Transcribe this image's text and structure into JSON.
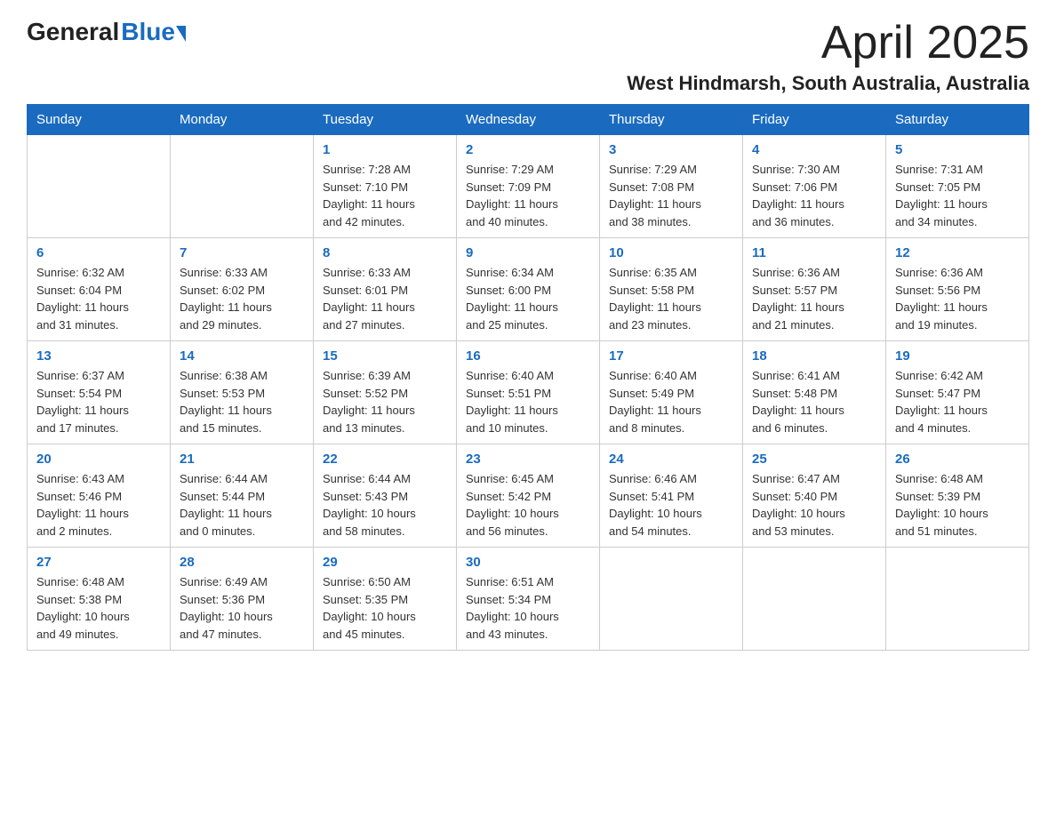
{
  "header": {
    "month_title": "April 2025",
    "location": "West Hindmarsh, South Australia, Australia",
    "logo_general": "General",
    "logo_blue": "Blue"
  },
  "days_of_week": [
    "Sunday",
    "Monday",
    "Tuesday",
    "Wednesday",
    "Thursday",
    "Friday",
    "Saturday"
  ],
  "weeks": [
    [
      {
        "day": "",
        "info": ""
      },
      {
        "day": "",
        "info": ""
      },
      {
        "day": "1",
        "info": "Sunrise: 7:28 AM\nSunset: 7:10 PM\nDaylight: 11 hours\nand 42 minutes."
      },
      {
        "day": "2",
        "info": "Sunrise: 7:29 AM\nSunset: 7:09 PM\nDaylight: 11 hours\nand 40 minutes."
      },
      {
        "day": "3",
        "info": "Sunrise: 7:29 AM\nSunset: 7:08 PM\nDaylight: 11 hours\nand 38 minutes."
      },
      {
        "day": "4",
        "info": "Sunrise: 7:30 AM\nSunset: 7:06 PM\nDaylight: 11 hours\nand 36 minutes."
      },
      {
        "day": "5",
        "info": "Sunrise: 7:31 AM\nSunset: 7:05 PM\nDaylight: 11 hours\nand 34 minutes."
      }
    ],
    [
      {
        "day": "6",
        "info": "Sunrise: 6:32 AM\nSunset: 6:04 PM\nDaylight: 11 hours\nand 31 minutes."
      },
      {
        "day": "7",
        "info": "Sunrise: 6:33 AM\nSunset: 6:02 PM\nDaylight: 11 hours\nand 29 minutes."
      },
      {
        "day": "8",
        "info": "Sunrise: 6:33 AM\nSunset: 6:01 PM\nDaylight: 11 hours\nand 27 minutes."
      },
      {
        "day": "9",
        "info": "Sunrise: 6:34 AM\nSunset: 6:00 PM\nDaylight: 11 hours\nand 25 minutes."
      },
      {
        "day": "10",
        "info": "Sunrise: 6:35 AM\nSunset: 5:58 PM\nDaylight: 11 hours\nand 23 minutes."
      },
      {
        "day": "11",
        "info": "Sunrise: 6:36 AM\nSunset: 5:57 PM\nDaylight: 11 hours\nand 21 minutes."
      },
      {
        "day": "12",
        "info": "Sunrise: 6:36 AM\nSunset: 5:56 PM\nDaylight: 11 hours\nand 19 minutes."
      }
    ],
    [
      {
        "day": "13",
        "info": "Sunrise: 6:37 AM\nSunset: 5:54 PM\nDaylight: 11 hours\nand 17 minutes."
      },
      {
        "day": "14",
        "info": "Sunrise: 6:38 AM\nSunset: 5:53 PM\nDaylight: 11 hours\nand 15 minutes."
      },
      {
        "day": "15",
        "info": "Sunrise: 6:39 AM\nSunset: 5:52 PM\nDaylight: 11 hours\nand 13 minutes."
      },
      {
        "day": "16",
        "info": "Sunrise: 6:40 AM\nSunset: 5:51 PM\nDaylight: 11 hours\nand 10 minutes."
      },
      {
        "day": "17",
        "info": "Sunrise: 6:40 AM\nSunset: 5:49 PM\nDaylight: 11 hours\nand 8 minutes."
      },
      {
        "day": "18",
        "info": "Sunrise: 6:41 AM\nSunset: 5:48 PM\nDaylight: 11 hours\nand 6 minutes."
      },
      {
        "day": "19",
        "info": "Sunrise: 6:42 AM\nSunset: 5:47 PM\nDaylight: 11 hours\nand 4 minutes."
      }
    ],
    [
      {
        "day": "20",
        "info": "Sunrise: 6:43 AM\nSunset: 5:46 PM\nDaylight: 11 hours\nand 2 minutes."
      },
      {
        "day": "21",
        "info": "Sunrise: 6:44 AM\nSunset: 5:44 PM\nDaylight: 11 hours\nand 0 minutes."
      },
      {
        "day": "22",
        "info": "Sunrise: 6:44 AM\nSunset: 5:43 PM\nDaylight: 10 hours\nand 58 minutes."
      },
      {
        "day": "23",
        "info": "Sunrise: 6:45 AM\nSunset: 5:42 PM\nDaylight: 10 hours\nand 56 minutes."
      },
      {
        "day": "24",
        "info": "Sunrise: 6:46 AM\nSunset: 5:41 PM\nDaylight: 10 hours\nand 54 minutes."
      },
      {
        "day": "25",
        "info": "Sunrise: 6:47 AM\nSunset: 5:40 PM\nDaylight: 10 hours\nand 53 minutes."
      },
      {
        "day": "26",
        "info": "Sunrise: 6:48 AM\nSunset: 5:39 PM\nDaylight: 10 hours\nand 51 minutes."
      }
    ],
    [
      {
        "day": "27",
        "info": "Sunrise: 6:48 AM\nSunset: 5:38 PM\nDaylight: 10 hours\nand 49 minutes."
      },
      {
        "day": "28",
        "info": "Sunrise: 6:49 AM\nSunset: 5:36 PM\nDaylight: 10 hours\nand 47 minutes."
      },
      {
        "day": "29",
        "info": "Sunrise: 6:50 AM\nSunset: 5:35 PM\nDaylight: 10 hours\nand 45 minutes."
      },
      {
        "day": "30",
        "info": "Sunrise: 6:51 AM\nSunset: 5:34 PM\nDaylight: 10 hours\nand 43 minutes."
      },
      {
        "day": "",
        "info": ""
      },
      {
        "day": "",
        "info": ""
      },
      {
        "day": "",
        "info": ""
      }
    ]
  ]
}
